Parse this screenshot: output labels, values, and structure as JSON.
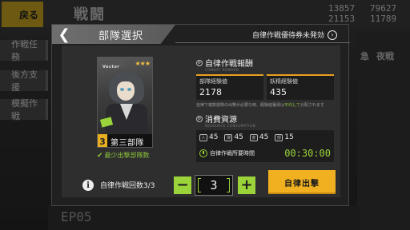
{
  "background": {
    "back_label": "戻る",
    "title": "戦闘",
    "resources_col1": [
      "13857",
      "21153"
    ],
    "resources_col2": [
      "79627",
      "11789"
    ],
    "left_menu": [
      "作戦任務",
      "後方支援",
      "模擬作戦"
    ],
    "right_labels": [
      "急",
      "夜戦"
    ],
    "episode": "EP05"
  },
  "modal": {
    "title": "部隊選択",
    "status_label": "自律作戦優待券未発効",
    "echelon": {
      "name": "第三部隊",
      "number": "3",
      "stars": "★★★",
      "weapon_label": "Vector",
      "min_echelon_label": "最少出撃部隊数"
    },
    "rewards": {
      "heading": "自律作戦報酬",
      "sub": "COMBAT REWARD",
      "echelon_exp_label": "部隊経験値",
      "echelon_exp_value": "2178",
      "fairy_exp_label": "妖精経験値",
      "fairy_exp_value": "435",
      "note_prefix": "自律で複数部隊の出撃が必要な時、経験値獲得は",
      "note_highlight": "平均して",
      "note_suffix": "分配されます"
    },
    "cost": {
      "heading": "消費資源",
      "sub": "RESOURCE CONSUMPTION",
      "items": [
        {
          "icon": "manpower-icon",
          "glyph": "人",
          "value": "45"
        },
        {
          "icon": "ammo-icon",
          "glyph": "弾",
          "value": "45"
        },
        {
          "icon": "ration-icon",
          "glyph": "食",
          "value": "45"
        },
        {
          "icon": "parts-icon",
          "glyph": "部",
          "value": "15"
        }
      ],
      "time_label": "自律作戦所要時間",
      "time_value": "00:30:00"
    },
    "controls": {
      "count_label": "自律作戦回数3/3",
      "minus": "−",
      "plus": "+",
      "count_value": "3",
      "deploy_label": "自律出撃"
    }
  },
  "colors": {
    "accent_green": "#9ad43a",
    "accent_yellow": "#f0b020",
    "panel_bg": "#2e2e2e"
  }
}
